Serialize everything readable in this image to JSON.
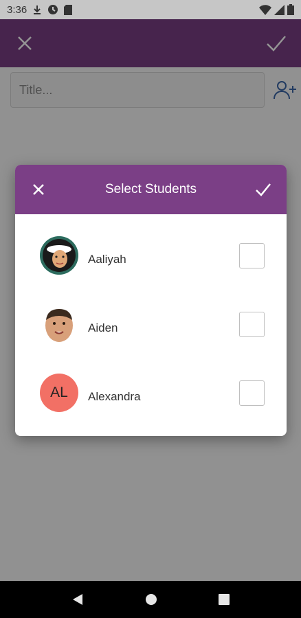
{
  "status_bar": {
    "time": "3:36"
  },
  "app_bar": {
    "close_icon": "close-icon",
    "confirm_icon": "check-icon"
  },
  "title_field": {
    "placeholder": "Title..."
  },
  "dialog": {
    "title": "Select Students",
    "students": [
      {
        "name": "Aaliyah",
        "avatar": "photo"
      },
      {
        "name": "Aiden",
        "avatar": "photo"
      },
      {
        "name": "Alexandra",
        "avatar": "initials",
        "initials": "AL"
      }
    ]
  },
  "colors": {
    "primary": "#7b3f86",
    "initials_bg": "#f27065"
  }
}
